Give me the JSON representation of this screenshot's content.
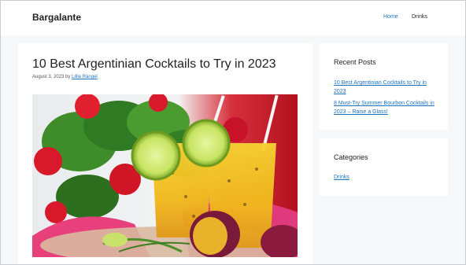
{
  "header": {
    "site_title": "Bargalante",
    "nav": [
      {
        "label": "Home",
        "active": true
      },
      {
        "label": "Drinks",
        "active": false
      }
    ]
  },
  "article": {
    "title": "10 Best Argentinian Cocktails to Try in 2023",
    "date": "August 3, 2023",
    "by": "by",
    "author": "Lillie Rangel",
    "image_description_icon": "cocktail-photo"
  },
  "sidebar": {
    "recent_posts": {
      "title": "Recent Posts",
      "items": [
        "10 Best Argentinian Cocktails to Try in 2023",
        "8 Must-Try Summer Bourbon Cocktails in 2023 – Raise a Glass!"
      ]
    },
    "categories": {
      "title": "Categories",
      "items": [
        "Drinks"
      ]
    }
  },
  "colors": {
    "link": "#1e73be",
    "background": "#f7f8f9",
    "card": "#ffffff"
  }
}
